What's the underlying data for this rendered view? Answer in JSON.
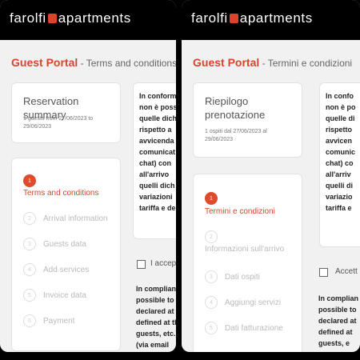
{
  "left": {
    "logo_left": "farolfi",
    "logo_right": "apartments",
    "portal_title": "Guest Portal",
    "title_separator": " - ",
    "page_subtitle": "Terms and conditions",
    "summary": {
      "title": "Reservation summary",
      "dates_line1": "1 guests from 27/06/2023 to",
      "dates_line2": "29/06/2023"
    },
    "terms_text": [
      "In conform",
      "non è poss",
      "quelle dich",
      "rispetto a",
      "avvicenda",
      "comunicat",
      "chat) con",
      "all'arrivo",
      "quelli dich",
      "variazioni",
      "tariffa e de"
    ],
    "steps": [
      {
        "number": "1",
        "label": "Terms and conditions",
        "active": true
      },
      {
        "number": "2",
        "label": "Arrival information",
        "active": false
      },
      {
        "number": "3",
        "label": "Guests data",
        "active": false
      },
      {
        "number": "4",
        "label": "Add services",
        "active": false
      },
      {
        "number": "5",
        "label": "Invoice data",
        "active": false
      },
      {
        "number": "6",
        "label": "Payment",
        "active": false
      }
    ],
    "accept_label": "I accept",
    "compliance_text": [
      "In complianc",
      "possible to ac",
      "declared at th",
      "defined at th",
      "guests, etc.)",
      "(via email"
    ]
  },
  "right": {
    "logo_left": "farolfi",
    "logo_right": "apartments",
    "portal_title": "Guest Portal",
    "title_separator": " - ",
    "page_subtitle": "Termini e condizioni",
    "summary": {
      "title_line1": "Riepilogo",
      "title_line2": "prenotazione",
      "dates_line1": "1 ospiti dal 27/06/2023 al",
      "dates_line2": "29/06/2023"
    },
    "terms_text": [
      "In confo",
      "non è po",
      "quelle di",
      "rispetto",
      "avvicen",
      "comunic",
      "chat) co",
      "all'arriv",
      "quelli di",
      "variazio",
      "tariffa e"
    ],
    "steps": [
      {
        "number": "1",
        "label": "Termini e condizioni",
        "active": true
      },
      {
        "number": "2",
        "label": "Informazioni sull'arrivo",
        "active": false
      },
      {
        "number": "3",
        "label": "Dati ospiti",
        "active": false
      },
      {
        "number": "4",
        "label": "Aggiungi servizi",
        "active": false
      },
      {
        "number": "5",
        "label": "Dati fatturazione",
        "active": false
      }
    ],
    "accept_label": "Accett",
    "compliance_text": [
      "In complian",
      "possible to",
      "declared at",
      "defined at",
      "guests, e"
    ]
  },
  "colors": {
    "accent": "#e04b2c",
    "topbar": "#000000",
    "background": "#f1f1f1"
  }
}
